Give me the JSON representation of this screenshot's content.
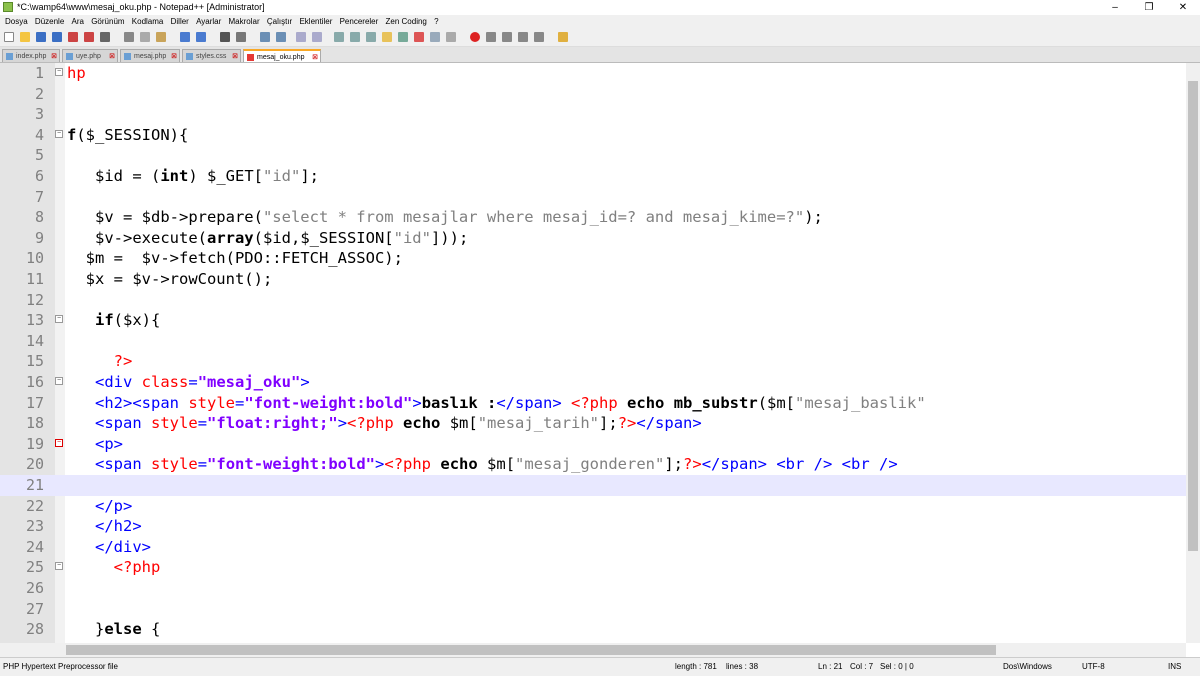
{
  "window": {
    "title": "*C:\\wamp64\\www\\mesaj_oku.php - Notepad++ [Administrator]",
    "min": "–",
    "max": "❐",
    "close": "✕"
  },
  "menu": [
    "Dosya",
    "Düzenle",
    "Ara",
    "Görünüm",
    "Kodlama",
    "Diller",
    "Ayarlar",
    "Makrolar",
    "Çalıştır",
    "Eklentiler",
    "Pencereler",
    "Zen Coding",
    "?"
  ],
  "tabs": [
    {
      "label": "index.php"
    },
    {
      "label": "uye.php"
    },
    {
      "label": "mesaj.php"
    },
    {
      "label": "styles.css"
    },
    {
      "label": "mesaj_oku.php"
    }
  ],
  "lines": [
    {
      "n": "1",
      "html": "<span class='p'>hp</span>"
    },
    {
      "n": "2",
      "html": ""
    },
    {
      "n": "3",
      "html": ""
    },
    {
      "n": "4",
      "html": "<span class='k'>f</span>($_SESSION){"
    },
    {
      "n": "5",
      "html": ""
    },
    {
      "n": "6",
      "html": "   $id = (<span class='k'>int</span>) $_GET[<span class='s'>\"id\"</span>];"
    },
    {
      "n": "7",
      "html": ""
    },
    {
      "n": "8",
      "html": "   $v = $db->prepare(<span class='s'>\"select * from mesajlar where mesaj_id=? and mesaj_kime=?\"</span>);"
    },
    {
      "n": "9",
      "html": "   $v->execute(<span class='k'>array</span>($id,$_SESSION[<span class='s'>\"id\"</span>]));"
    },
    {
      "n": "10",
      "html": "  $m =  $v->fetch(PDO::FETCH_ASSOC);"
    },
    {
      "n": "11",
      "html": "  $x = $v->rowCount();"
    },
    {
      "n": "12",
      "html": ""
    },
    {
      "n": "13",
      "html": "   <span class='k'>if</span>($x){"
    },
    {
      "n": "14",
      "html": ""
    },
    {
      "n": "15",
      "html": "     <span class='p'>?></span>"
    },
    {
      "n": "16",
      "html": "   <span class='t'>&lt;div</span> <span class='a'>class</span><span class='t'>=</span><span class='av'>\"mesaj_oku\"</span><span class='t'>&gt;</span>"
    },
    {
      "n": "17",
      "html": "   <span class='t'>&lt;h2&gt;&lt;span</span> <span class='a'>style</span><span class='t'>=</span><span class='av'>\"font-weight:bold\"</span><span class='t'>&gt;</span><span class='k'>baslık :</span><span class='t'>&lt;/span&gt;</span> <span class='p'>&lt;?php</span> <span class='k'>echo mb_substr</span>($m[<span class='s'>\"mesaj_baslik\"</span>"
    },
    {
      "n": "18",
      "html": "   <span class='t'>&lt;span</span> <span class='a'>style</span><span class='t'>=</span><span class='av'>\"float:right;\"</span><span class='t'>&gt;</span><span class='p'>&lt;?php</span> <span class='k'>echo</span> $m[<span class='s'>\"mesaj_tarih\"</span>];<span class='p'>?></span><span class='t'>&lt;/span&gt;</span>"
    },
    {
      "n": "19",
      "html": "   <span class='t'>&lt;p&gt;</span>"
    },
    {
      "n": "20",
      "html": "   <span class='t'>&lt;span</span> <span class='a'>style</span><span class='t'>=</span><span class='av'>\"font-weight:bold\"</span><span class='t'>&gt;</span><span class='p'>&lt;?php</span> <span class='k'>echo</span> $m[<span class='s'>\"mesaj_gonderen\"</span>];<span class='p'>?></span><span class='t'>&lt;/span&gt; &lt;br /&gt; &lt;br /&gt;</span>"
    },
    {
      "n": "21",
      "html": ""
    },
    {
      "n": "22",
      "html": "   <span class='t'>&lt;/p&gt;</span>"
    },
    {
      "n": "23",
      "html": "   <span class='t'>&lt;/h2&gt;</span>"
    },
    {
      "n": "24",
      "html": "   <span class='t'>&lt;/div&gt;</span>"
    },
    {
      "n": "25",
      "html": "     <span class='p'>&lt;?php</span>"
    },
    {
      "n": "26",
      "html": ""
    },
    {
      "n": "27",
      "html": ""
    },
    {
      "n": "28",
      "html": "   }<span class='k'>else</span> {"
    }
  ],
  "status": {
    "filetype": "PHP Hypertext Preprocessor file",
    "length": "length : 781",
    "lines": "lines : 38",
    "ln": "Ln : 21",
    "col": "Col : 7",
    "sel": "Sel : 0 | 0",
    "eol": "Dos\\Windows",
    "encoding": "UTF-8",
    "mode": "INS"
  },
  "colors": {
    "keyword": "#000000",
    "string": "#808080",
    "tag": "#0000ff",
    "attr": "#ff0000",
    "attrval": "#8000ff",
    "php": "#ff0000",
    "gutter": "#e4e4e4"
  }
}
